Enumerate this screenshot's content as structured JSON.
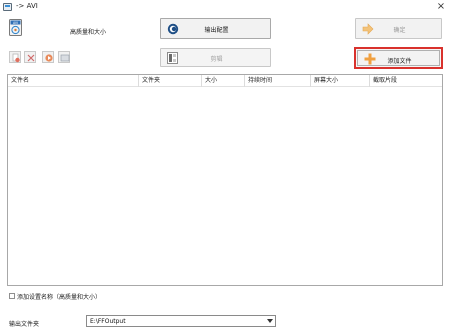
{
  "window": {
    "title": "-> AVI",
    "close_glyph": "×"
  },
  "header": {
    "preset_label": "高质量和大小",
    "output_config_label": "输出配置",
    "ok_label": "确定",
    "cut_label": "剪辑",
    "add_file_label": "添加文件"
  },
  "toolbar": {
    "icons": [
      "remove-file-icon",
      "clear-list-icon",
      "play-icon",
      "media-info-icon"
    ]
  },
  "table": {
    "columns": [
      "文件名",
      "文件夹",
      "大小",
      "持续时间",
      "屏幕大小",
      "截取片段"
    ],
    "rows": []
  },
  "footer": {
    "add_preset_name_label": "添加设置名称（高质量和大小）",
    "add_preset_name_checked": false,
    "output_folder_label": "输出文件夹",
    "output_folder_value": "E:\\FFOutput"
  },
  "colors": {
    "highlight": "#d9322d",
    "add_icon": "#f0a040",
    "ok_icon": "#f3c37a"
  }
}
